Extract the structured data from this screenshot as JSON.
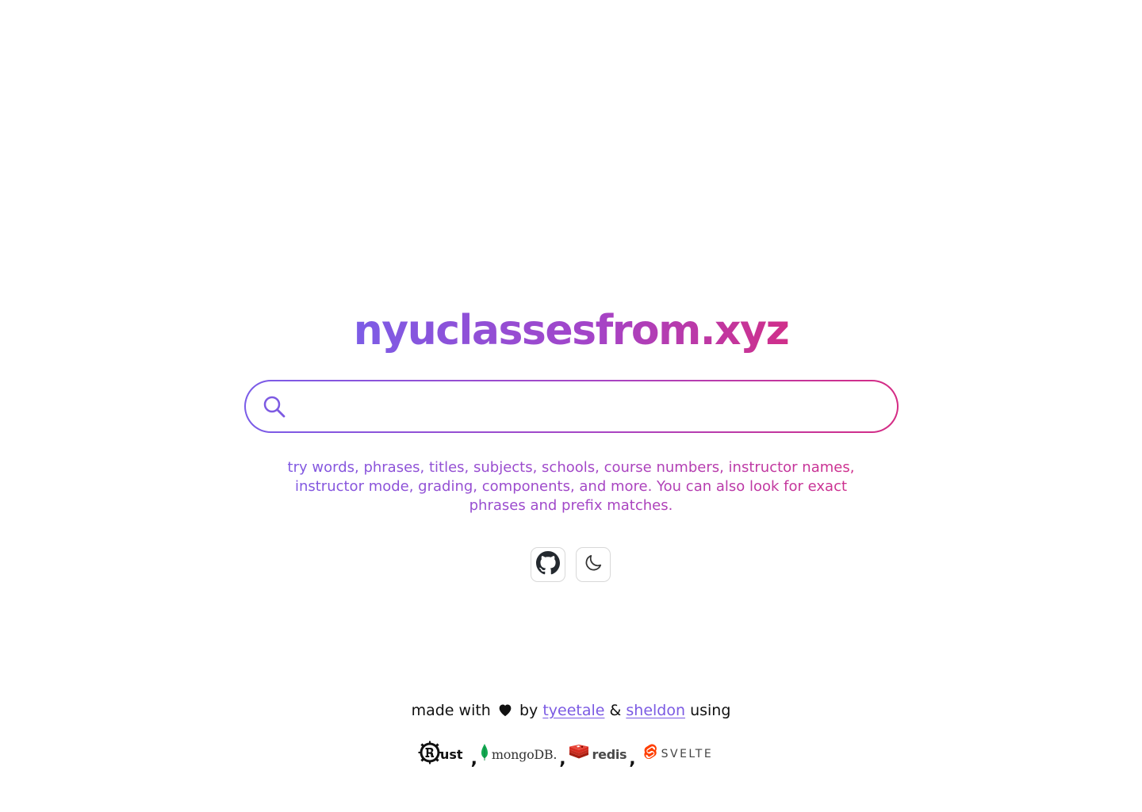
{
  "header": {
    "title": "nyuclassesfrom.xyz"
  },
  "search": {
    "icon": "search-icon",
    "value": "",
    "placeholder": ""
  },
  "hint": {
    "text": "try words, phrases, titles, subjects, schools, course numbers, instructor names, instructor mode, grading, components, and more. You can also look for exact phrases and prefix matches."
  },
  "actions": [
    {
      "icon": "github-icon"
    },
    {
      "icon": "moon-icon"
    }
  ],
  "footer": {
    "prefix": "made with",
    "heart_icon": "heart-icon",
    "by": "by",
    "author1": "tyeetale",
    "ampersand": "&",
    "author2": "sheldon",
    "suffix": "using",
    "separator": ",",
    "tech": {
      "rust": "ust",
      "mongodb": "mongoDB.",
      "redis": "redis",
      "svelte": "SVELTE"
    }
  },
  "colors": {
    "gradient_start": "#7c5ce6",
    "gradient_end": "#d02f8a",
    "link": "#7b5ae3",
    "rust": "#111111",
    "mongodb_leaf": "#13aa52",
    "redis": "#d82c20",
    "svelte": "#ff3e00"
  }
}
